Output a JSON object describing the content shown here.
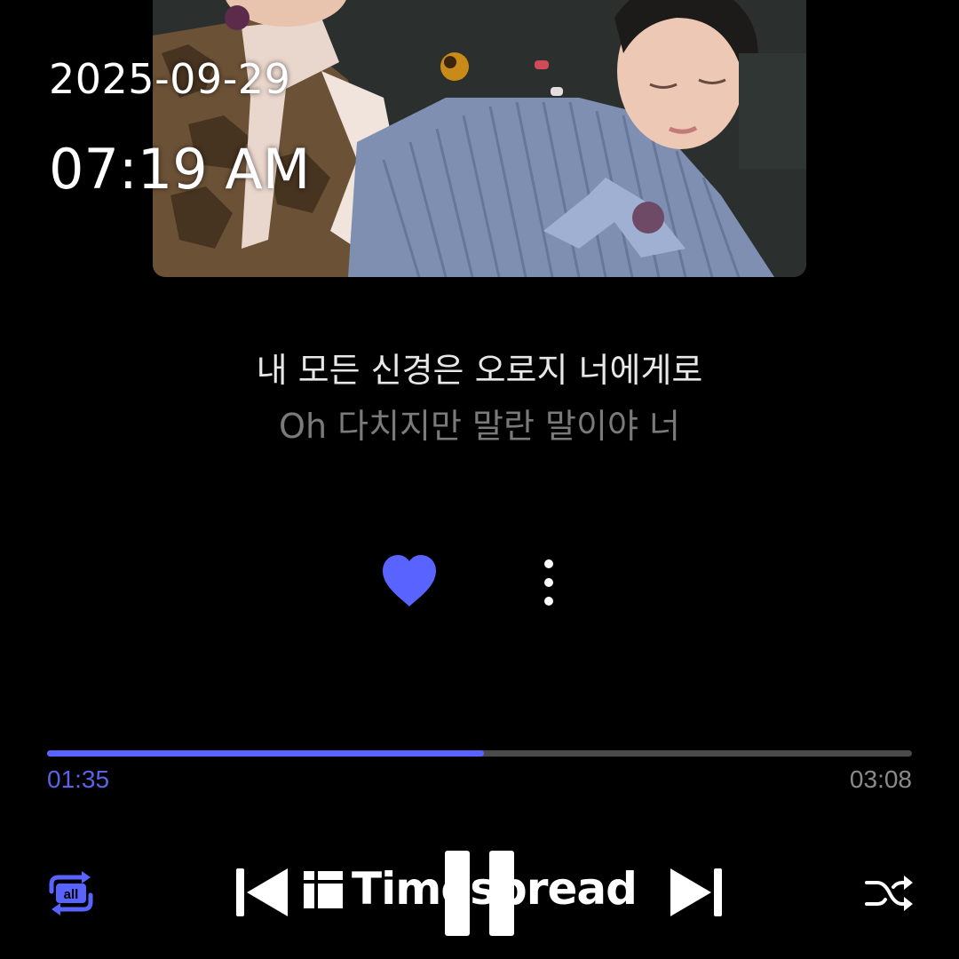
{
  "status": {
    "date": "2025-09-29",
    "time": "07:19 AM"
  },
  "lyrics": {
    "current": "내 모든 신경은 오로지 너에게로",
    "next": "Oh 다치지만 말란 말이야 너"
  },
  "actions": {
    "liked": true,
    "heart_icon": "heart-icon",
    "more_icon": "more-vertical-icon"
  },
  "playback": {
    "elapsed": "01:35",
    "total": "03:08",
    "progress_fraction": 0.505,
    "repeat_mode": "all",
    "state": "playing"
  },
  "watermark": {
    "text": "Timespread"
  },
  "colors": {
    "accent": "#5963ff",
    "background": "#000000",
    "track": "#4a4a4a",
    "lyric_current": "#e8e8e8",
    "lyric_next": "#7a7a7a"
  }
}
